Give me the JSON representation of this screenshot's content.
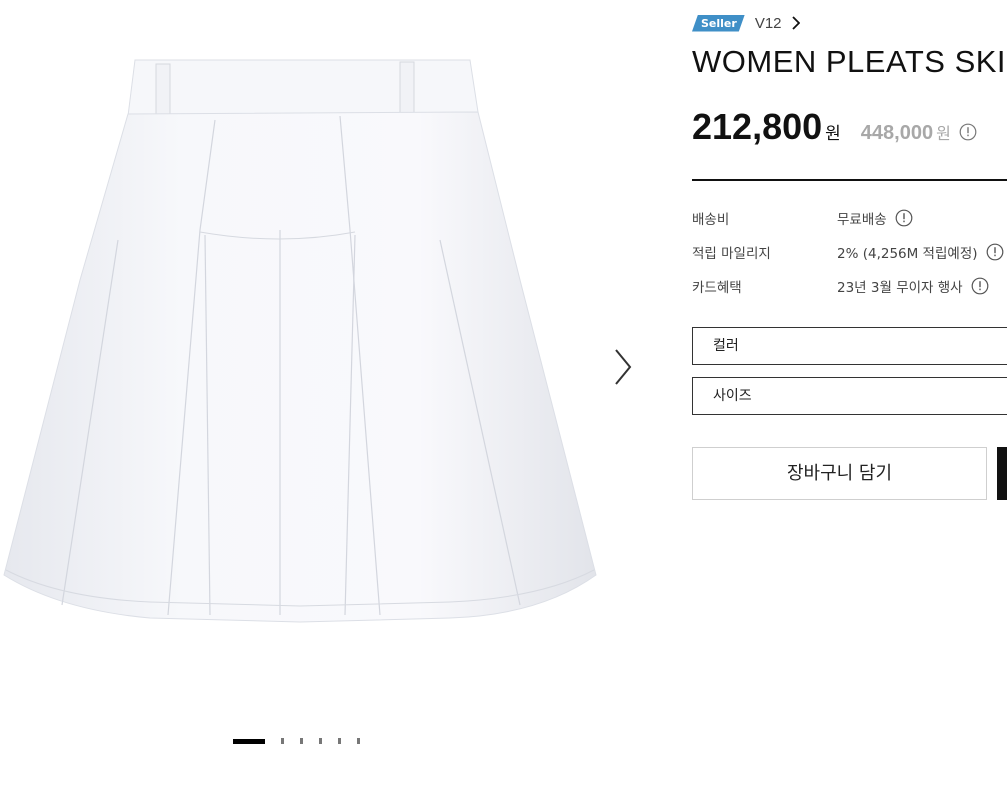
{
  "gallery": {
    "image_alt": "white pleated skirt",
    "slide_count": 6,
    "active_slide": 1
  },
  "seller": {
    "badge": "Seller",
    "brand": "V12"
  },
  "product": {
    "title": "WOMEN PLEATS SKIRT_",
    "price": "212,800",
    "price_unit": "원",
    "original_price": "448,000",
    "original_unit": "원"
  },
  "specs": [
    {
      "label": "배송비",
      "value": "무료배송"
    },
    {
      "label": "적립 마일리지",
      "value": "2% (4,256M 적립예정)"
    },
    {
      "label": "카드혜택",
      "value": "23년 3월 무이자 행사"
    }
  ],
  "options": {
    "color_label": "컬러",
    "size_label": "사이즈"
  },
  "actions": {
    "cart_label": "장바구니 담기"
  },
  "colors": {
    "seller_badge": "#3f8fc7",
    "text_primary": "#111111",
    "text_muted": "#a8a8a8"
  },
  "icons": [
    "chevron-right-icon",
    "info-icon",
    "next-slide-icon"
  ]
}
